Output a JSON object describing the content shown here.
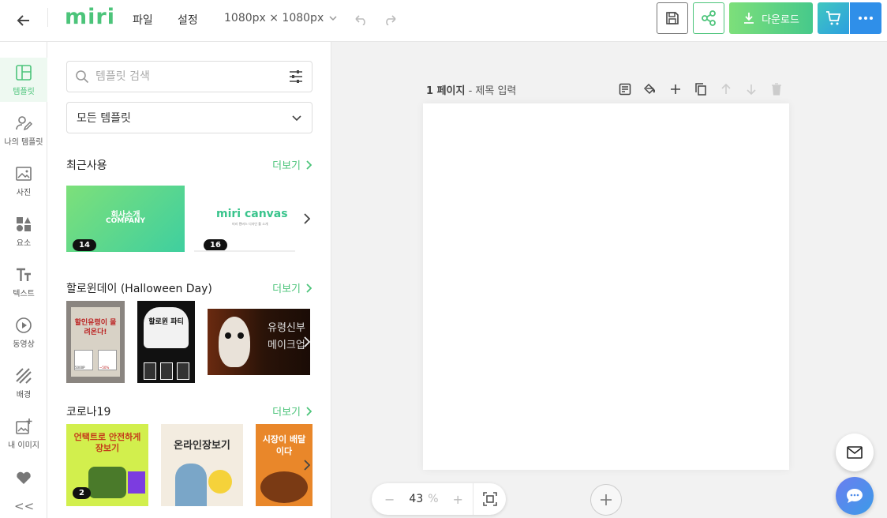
{
  "header": {
    "logo": "miri",
    "menu": [
      "파일",
      "설정"
    ],
    "size": "1080px × 1080px",
    "download_label": "다운로드"
  },
  "sidebar": {
    "items": [
      {
        "label": "템플릿",
        "icon": "layout-icon",
        "active": true
      },
      {
        "label": "나의 템플릿",
        "icon": "user-edit-icon"
      },
      {
        "label": "사진",
        "icon": "image-icon"
      },
      {
        "label": "요소",
        "icon": "shapes-icon"
      },
      {
        "label": "텍스트",
        "icon": "text-icon"
      },
      {
        "label": "동영상",
        "icon": "play-icon"
      },
      {
        "label": "배경",
        "icon": "pattern-icon"
      },
      {
        "label": "내 이미지",
        "icon": "image-add-icon"
      },
      {
        "label": "",
        "icon": "heart-icon"
      }
    ],
    "collapse": "<<"
  },
  "panel": {
    "search_placeholder": "템플릿 검색",
    "dropdown": "모든 템플릿",
    "more_label": "더보기",
    "sections": [
      {
        "title": "최근사용",
        "badges": [
          "14",
          "16"
        ]
      },
      {
        "title": "할로윈데이 (Halloween Day)"
      },
      {
        "title": "코로나19",
        "badges": [
          "2"
        ]
      }
    ],
    "thumb_texts": {
      "company_1": "회사소개",
      "company_2": "COMPANY",
      "canvas_logo": "miri canvas",
      "canvas_sub": "미리 캔버스 디자인 툴 소개",
      "halloween_1": "할인유령이 몰려온다!",
      "halloween_1_price_a": "5000P",
      "halloween_1_price_b": "~50%",
      "halloween_2": "할로윈 파티",
      "halloween_3": "유령신부 메이크업",
      "corona_1": "언택트로 안전하게 장보기",
      "corona_2": "온라인장보기",
      "corona_3": "시장이 배달이다"
    }
  },
  "workspace": {
    "page_number": "1 페이지",
    "page_title_placeholder": " - 제목 입력",
    "zoom_value": "43",
    "zoom_unit": "%"
  },
  "colors": {
    "brand_green": "#4cc47a",
    "accent_blue": "#2f8fe9"
  }
}
